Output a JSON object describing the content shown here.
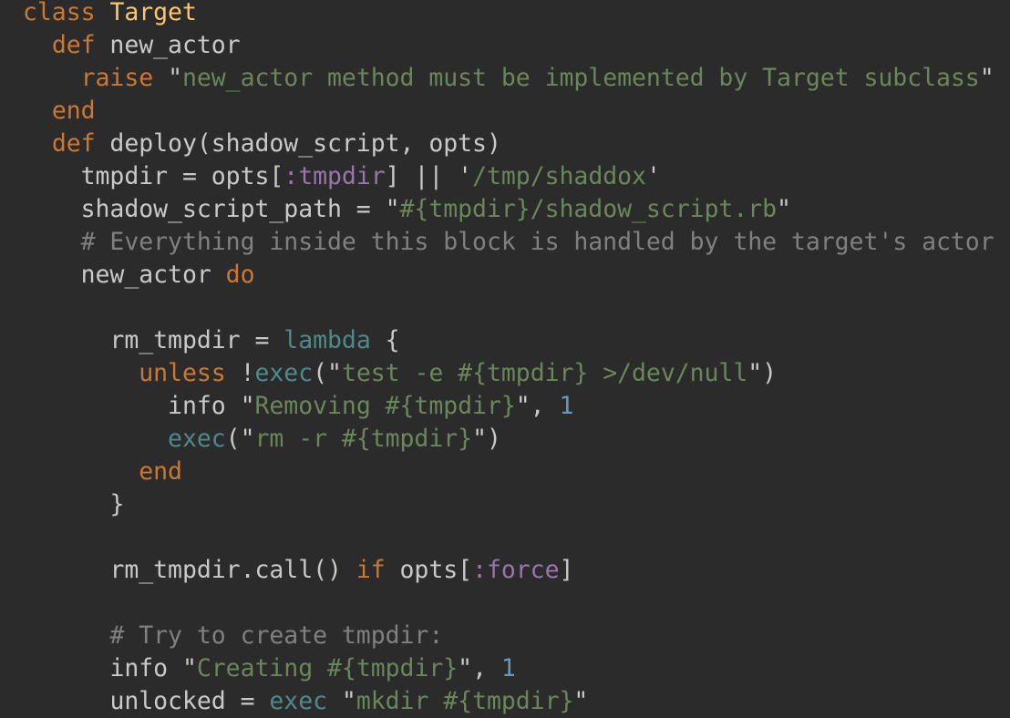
{
  "editor": {
    "language": "ruby",
    "colors": {
      "background": "#2b2b2b",
      "default": "#c9c9c9",
      "keyword": "#cc7832",
      "class_name": "#ffc66d",
      "string": "#6a8759",
      "symbol": "#9876aa",
      "comment": "#808080",
      "number": "#6897bb",
      "builtin": "#4e8a8a"
    },
    "lines": [
      {
        "indent": 0,
        "tokens": [
          [
            "kw",
            "class"
          ],
          [
            "id",
            " "
          ],
          [
            "cls",
            "Target"
          ]
        ]
      },
      {
        "indent": 2,
        "tokens": [
          [
            "kw",
            "def"
          ],
          [
            "id",
            " new_actor"
          ]
        ]
      },
      {
        "indent": 4,
        "tokens": [
          [
            "kw",
            "raise"
          ],
          [
            "id",
            " "
          ],
          [
            "q",
            "\""
          ],
          [
            "str",
            "new_actor method must be implemented by Target subclass"
          ],
          [
            "q",
            "\""
          ]
        ]
      },
      {
        "indent": 2,
        "tokens": [
          [
            "kw",
            "end"
          ]
        ]
      },
      {
        "indent": 2,
        "tokens": [
          [
            "kw",
            "def"
          ],
          [
            "id",
            " deploy(shadow_script, opts)"
          ]
        ]
      },
      {
        "indent": 4,
        "tokens": [
          [
            "id",
            "tmpdir = opts["
          ],
          [
            "sym",
            ":tmpdir"
          ],
          [
            "id",
            "] || "
          ],
          [
            "q",
            "'"
          ],
          [
            "str",
            "/tmp/shaddox"
          ],
          [
            "q",
            "'"
          ]
        ]
      },
      {
        "indent": 4,
        "tokens": [
          [
            "id",
            "shadow_script_path = "
          ],
          [
            "q",
            "\""
          ],
          [
            "str",
            "#{tmpdir}/shadow_script.rb"
          ],
          [
            "q",
            "\""
          ]
        ]
      },
      {
        "indent": 4,
        "tokens": [
          [
            "cmt",
            "# Everything inside this block is handled by the target's actor"
          ]
        ]
      },
      {
        "indent": 4,
        "tokens": [
          [
            "id",
            "new_actor "
          ],
          [
            "kw",
            "do"
          ]
        ]
      },
      {
        "indent": 0,
        "tokens": []
      },
      {
        "indent": 6,
        "tokens": [
          [
            "id",
            "rm_tmpdir = "
          ],
          [
            "bi",
            "lambda"
          ],
          [
            "id",
            " {"
          ]
        ]
      },
      {
        "indent": 8,
        "tokens": [
          [
            "kw",
            "unless"
          ],
          [
            "id",
            " !"
          ],
          [
            "bi",
            "exec"
          ],
          [
            "id",
            "("
          ],
          [
            "q",
            "\""
          ],
          [
            "str",
            "test -e #{tmpdir} >/dev/null"
          ],
          [
            "q",
            "\""
          ],
          [
            "id",
            ")"
          ]
        ]
      },
      {
        "indent": 10,
        "tokens": [
          [
            "id",
            "info "
          ],
          [
            "q",
            "\""
          ],
          [
            "str",
            "Removing #{tmpdir}"
          ],
          [
            "q",
            "\""
          ],
          [
            "id",
            ", "
          ],
          [
            "num",
            "1"
          ]
        ]
      },
      {
        "indent": 10,
        "tokens": [
          [
            "bi",
            "exec"
          ],
          [
            "id",
            "("
          ],
          [
            "q",
            "\""
          ],
          [
            "str",
            "rm -r #{tmpdir}"
          ],
          [
            "q",
            "\""
          ],
          [
            "id",
            ")"
          ]
        ]
      },
      {
        "indent": 8,
        "tokens": [
          [
            "kw",
            "end"
          ]
        ]
      },
      {
        "indent": 6,
        "tokens": [
          [
            "id",
            "}"
          ]
        ]
      },
      {
        "indent": 0,
        "tokens": []
      },
      {
        "indent": 6,
        "tokens": [
          [
            "id",
            "rm_tmpdir.call() "
          ],
          [
            "kw",
            "if"
          ],
          [
            "id",
            " opts["
          ],
          [
            "sym",
            ":force"
          ],
          [
            "id",
            "]"
          ]
        ]
      },
      {
        "indent": 0,
        "tokens": []
      },
      {
        "indent": 6,
        "tokens": [
          [
            "cmt",
            "# Try to create tmpdir:"
          ]
        ]
      },
      {
        "indent": 6,
        "tokens": [
          [
            "id",
            "info "
          ],
          [
            "q",
            "\""
          ],
          [
            "str",
            "Creating #{tmpdir}"
          ],
          [
            "q",
            "\""
          ],
          [
            "id",
            ", "
          ],
          [
            "num",
            "1"
          ]
        ]
      },
      {
        "indent": 6,
        "tokens": [
          [
            "id",
            "unlocked = "
          ],
          [
            "bi",
            "exec"
          ],
          [
            "id",
            " "
          ],
          [
            "q",
            "\""
          ],
          [
            "str",
            "mkdir #{tmpdir}"
          ],
          [
            "q",
            "\""
          ]
        ]
      }
    ]
  }
}
